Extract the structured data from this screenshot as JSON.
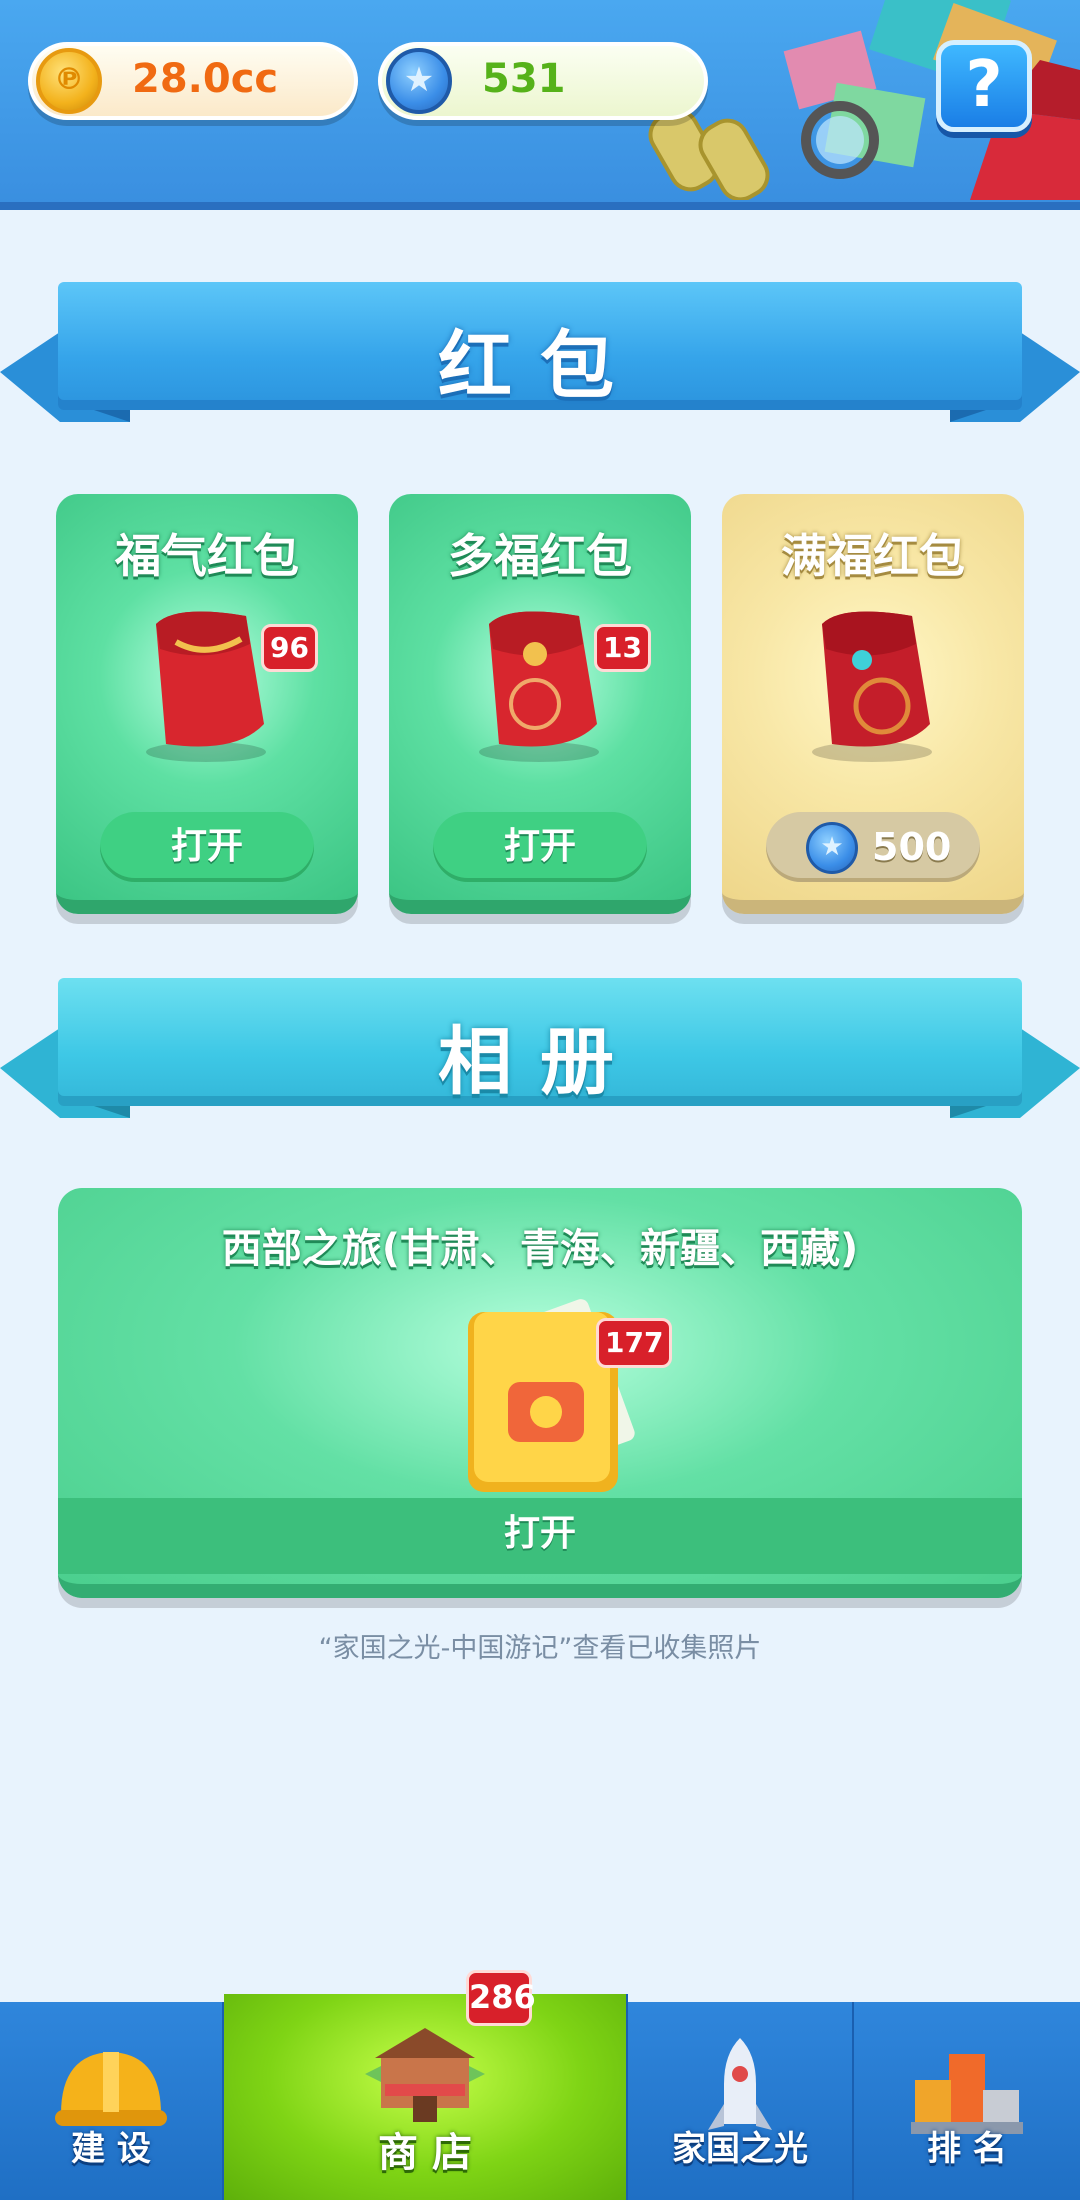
{
  "topbar": {
    "coin": {
      "icon": "coin-icon",
      "glyph": "℗",
      "value": "28.0cc"
    },
    "gem": {
      "icon": "star-gem-icon",
      "glyph": "★",
      "value": "531"
    },
    "help_glyph": "?"
  },
  "sections": {
    "red_packet_title": "红包",
    "album_title": "相册"
  },
  "red_packets": [
    {
      "title": "福气红包",
      "badge": "96",
      "button": "打开"
    },
    {
      "title": "多福红包",
      "badge": "13",
      "button": "打开"
    },
    {
      "title": "满福红包",
      "price_glyph": "★",
      "price": "500"
    }
  ],
  "album": {
    "title": "西部之旅(甘肃、青海、新疆、西藏)",
    "badge": "177",
    "button": "打开",
    "hint": "“家国之光-中国游记”查看已收集照片"
  },
  "bottom_nav": {
    "badge": "286",
    "items": [
      {
        "label": "建 设",
        "icon": "hardhat-icon",
        "active": false
      },
      {
        "label": "商 店",
        "icon": "shop-icon",
        "active": true
      },
      {
        "label": "家国之光",
        "icon": "rocket-icon",
        "active": false
      },
      {
        "label": "排 名",
        "icon": "podium-icon",
        "active": false
      }
    ]
  },
  "colors": {
    "topbar": "#3a8fe0",
    "card_green": "#4bcf8e",
    "card_gold": "#f3dd96",
    "badge_red": "#d8202a",
    "nav_active": "#7fd415"
  }
}
